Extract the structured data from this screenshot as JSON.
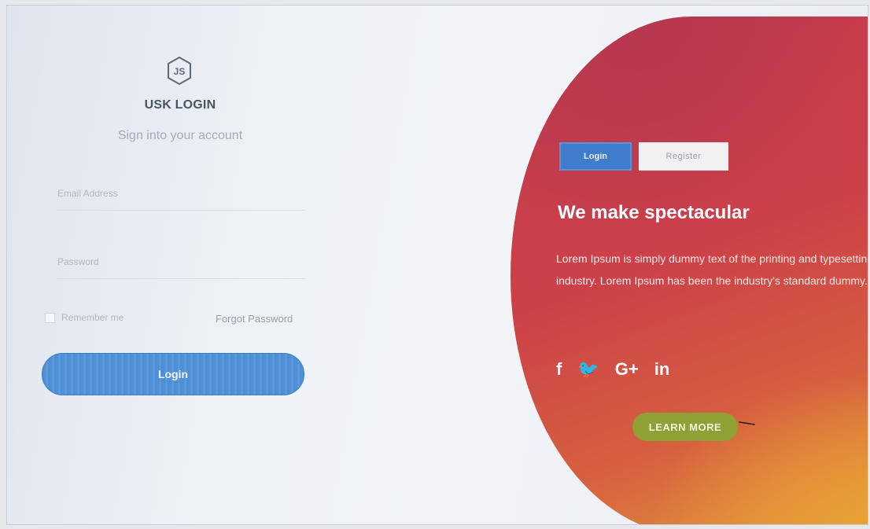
{
  "login_card": {
    "brand": "USK LOGIN",
    "subtitle": "Sign into your account",
    "email_placeholder": "Email Address",
    "password_placeholder": "Password",
    "remember_label": "Remember me",
    "forgot_label": "Forgot Password",
    "login_button": "Login"
  },
  "promo": {
    "tabs": [
      {
        "label": "Login",
        "active": true
      },
      {
        "label": "Register",
        "active": false
      }
    ],
    "heading": "We make spectacular",
    "body": "Lorem Ipsum is simply dummy text of the printing and typesetting industry. Lorem Ipsum has been the industry's standard dummy.",
    "socials": [
      {
        "icon": "facebook-icon",
        "glyph": "f"
      },
      {
        "icon": "twitter-icon",
        "glyph": "🐦"
      },
      {
        "icon": "google-plus-icon",
        "glyph": "G+"
      },
      {
        "icon": "linkedin-icon",
        "glyph": "in"
      }
    ],
    "cta": "LEARN MORE"
  },
  "colors": {
    "primary_blue": "#4c8fd7",
    "cta_green": "#8fa034",
    "panel_red": "#c83e4b",
    "panel_orange": "#e39a3b"
  }
}
